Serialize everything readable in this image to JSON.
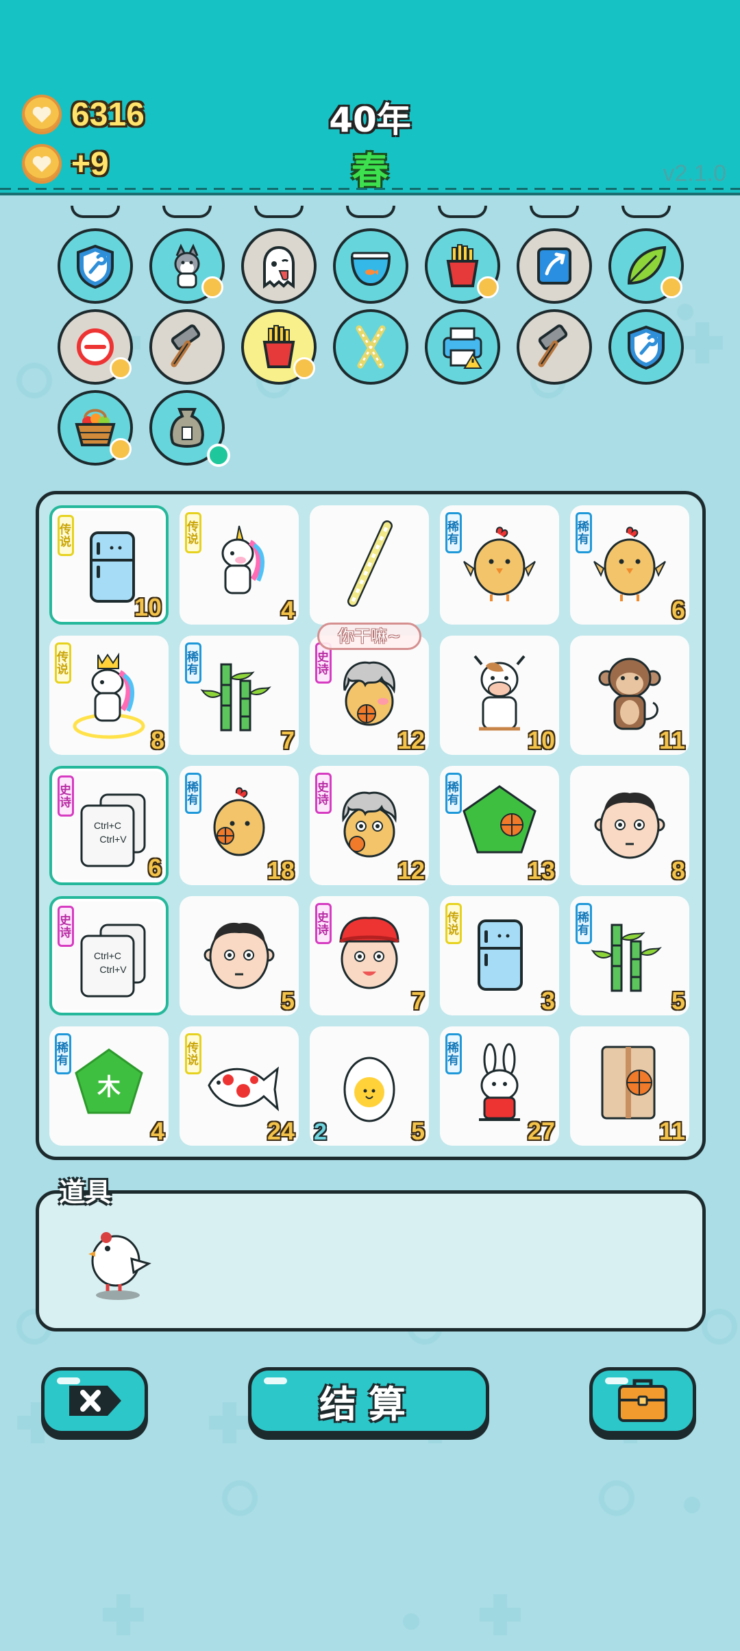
{
  "header": {
    "coins": "6316",
    "income": "+9",
    "year": "40年",
    "season": "春",
    "version": "v2.1.0"
  },
  "inventory": {
    "items": [
      {
        "icon": "shield-wrench-icon",
        "style": "teal",
        "heart": false
      },
      {
        "icon": "husky-dog-icon",
        "style": "teal",
        "heart": true
      },
      {
        "icon": "ghost-icon",
        "style": "gray",
        "heart": false
      },
      {
        "icon": "fishbowl-icon",
        "style": "teal",
        "heart": false
      },
      {
        "icon": "french-fries-icon",
        "style": "teal",
        "heart": true
      },
      {
        "icon": "arrow-up-card-icon",
        "style": "gray",
        "heart": false
      },
      {
        "icon": "leaf-icon",
        "style": "teal",
        "heart": true
      },
      {
        "icon": "minus-circle-icon",
        "style": "gray",
        "heart": true
      },
      {
        "icon": "hammer-icon",
        "style": "gray",
        "heart": false
      },
      {
        "icon": "french-fries-icon",
        "style": "yellow",
        "heart": true
      },
      {
        "icon": "crossed-sticks-icon",
        "style": "teal",
        "heart": false
      },
      {
        "icon": "printer-icon",
        "style": "teal",
        "heart": false
      },
      {
        "icon": "hammer-icon",
        "style": "gray",
        "heart": false
      },
      {
        "icon": "shield-wrench-icon",
        "style": "teal",
        "heart": false
      },
      {
        "icon": "fruit-basket-icon",
        "style": "teal",
        "heart": true
      },
      {
        "icon": "sack-icon",
        "style": "teal",
        "heart": false
      }
    ]
  },
  "board": {
    "speech_bubble": "你干嘛~",
    "cells": [
      {
        "icon": "fridge-icon",
        "tag": "传说",
        "tag_type": "legend",
        "value": "10",
        "highlight": true
      },
      {
        "icon": "unicorn-icon",
        "tag": "传说",
        "tag_type": "legend",
        "value": "4"
      },
      {
        "icon": "straw-icon",
        "tag": "",
        "tag_type": "",
        "value": ""
      },
      {
        "icon": "chick-icon",
        "tag": "稀有",
        "tag_type": "rare",
        "value": ""
      },
      {
        "icon": "chick-icon",
        "tag": "稀有",
        "tag_type": "rare",
        "value": "6"
      },
      {
        "icon": "unicorn-king-icon",
        "tag": "传说",
        "tag_type": "legend",
        "value": "8"
      },
      {
        "icon": "bamboo-icon",
        "tag": "稀有",
        "tag_type": "rare",
        "value": "7"
      },
      {
        "icon": "chick-gray-hair-basketball-icon",
        "tag": "史诗",
        "tag_type": "epic",
        "value": "12"
      },
      {
        "icon": "cow-icon",
        "tag": "",
        "tag_type": "",
        "value": "10"
      },
      {
        "icon": "monkey-icon",
        "tag": "",
        "tag_type": "",
        "value": "11"
      },
      {
        "icon": "copy-paste-icon",
        "tag": "史诗",
        "tag_type": "epic",
        "value": "6",
        "highlight": true
      },
      {
        "icon": "chick-basketball-icon",
        "tag": "稀有",
        "tag_type": "rare",
        "value": "18"
      },
      {
        "icon": "chick-gray-hair-icon",
        "tag": "史诗",
        "tag_type": "epic",
        "value": "12"
      },
      {
        "icon": "green-pentagon-basketball-icon",
        "tag": "稀有",
        "tag_type": "rare",
        "value": "13"
      },
      {
        "icon": "man-face-icon",
        "tag": "",
        "tag_type": "",
        "value": "8"
      },
      {
        "icon": "copy-paste-icon",
        "tag": "史诗",
        "tag_type": "epic",
        "value": "",
        "highlight": true
      },
      {
        "icon": "man-face-icon",
        "tag": "",
        "tag_type": "",
        "value": "5"
      },
      {
        "icon": "red-cap-face-icon",
        "tag": "史诗",
        "tag_type": "epic",
        "value": "7"
      },
      {
        "icon": "fridge-icon",
        "tag": "传说",
        "tag_type": "legend",
        "value": "3"
      },
      {
        "icon": "bamboo-icon",
        "tag": "稀有",
        "tag_type": "rare",
        "value": "5"
      },
      {
        "icon": "wood-pentagon-icon",
        "tag": "稀有",
        "tag_type": "rare",
        "value": "4",
        "text": "木"
      },
      {
        "icon": "koi-fish-icon",
        "tag": "传说",
        "tag_type": "legend",
        "value": "24"
      },
      {
        "icon": "egg-icon",
        "tag": "",
        "tag_type": "",
        "value": "5",
        "value_left": "2"
      },
      {
        "icon": "rabbit-icon",
        "tag": "稀有",
        "tag_type": "rare",
        "value": "27"
      },
      {
        "icon": "basketball-box-icon",
        "tag": "",
        "tag_type": "",
        "value": "11"
      }
    ]
  },
  "props": {
    "title": "道具",
    "items": [
      {
        "icon": "white-bird-icon"
      }
    ]
  },
  "buttons": {
    "close": "close-x-icon",
    "settle": "结算",
    "bag": "briefcase-icon"
  },
  "colors": {
    "header_bg": "#17c2c4",
    "page_bg": "#aadde6",
    "button": "#2cc7c9",
    "outline": "#1d2a2d",
    "legend": "#e6d21e",
    "rare": "#1e98d8",
    "epic": "#d63bc1",
    "coin_text": "#ffe36a",
    "season": "#3de04e"
  }
}
